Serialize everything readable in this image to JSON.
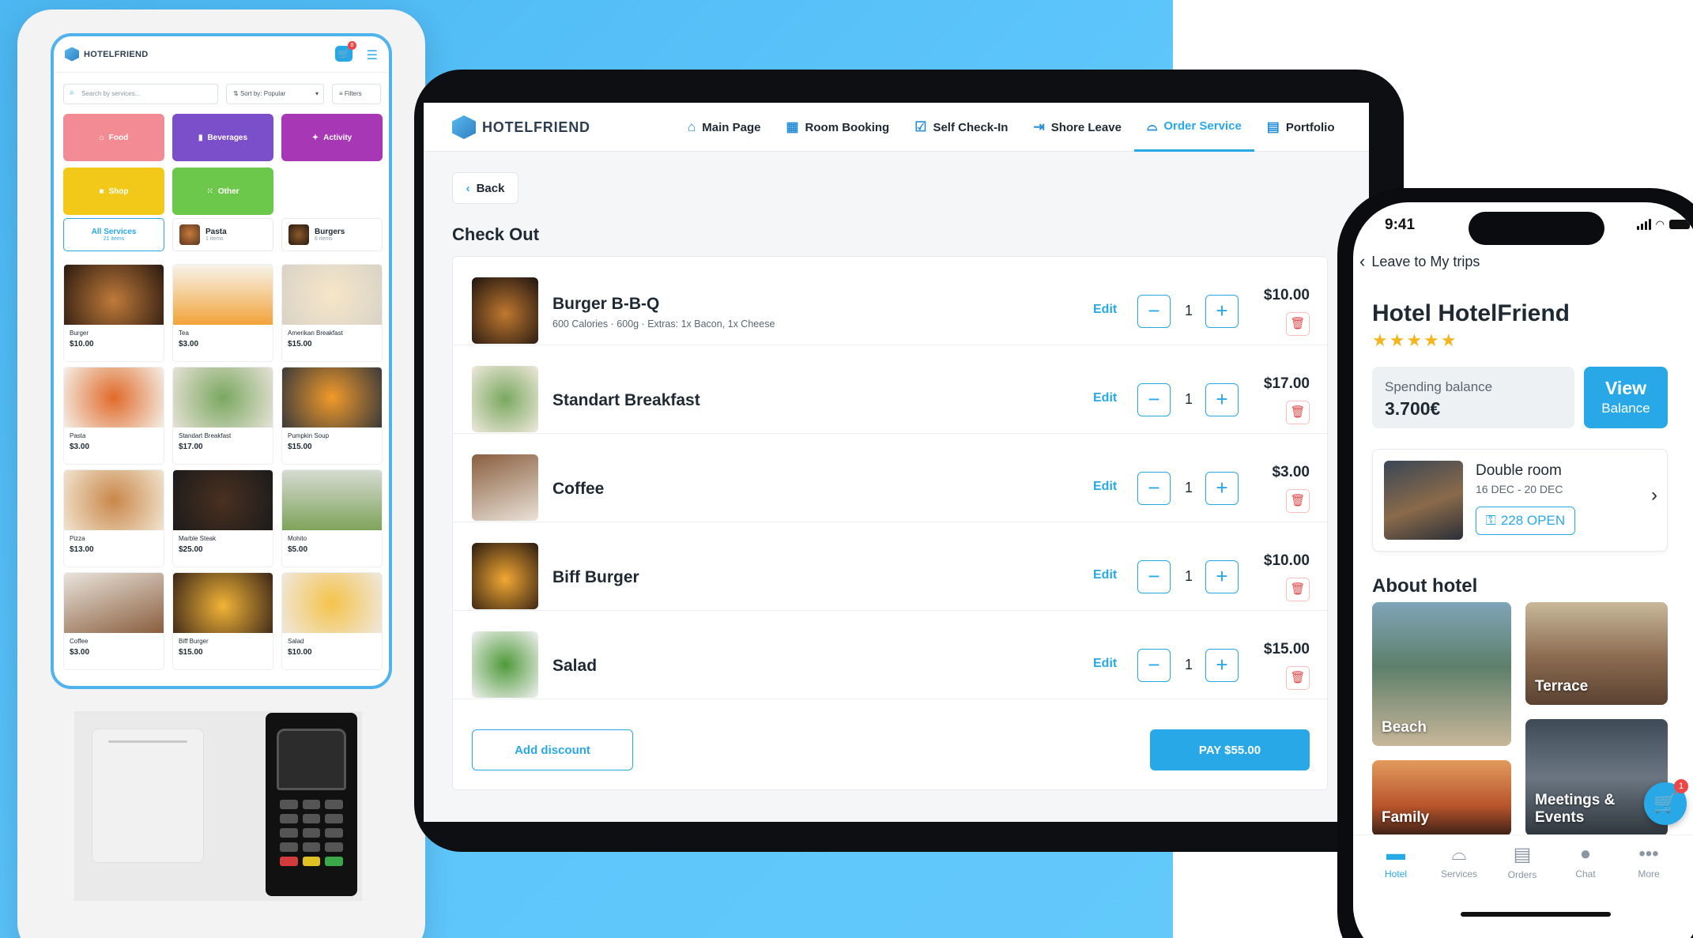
{
  "kiosk": {
    "logo": "HOTELFRIEND",
    "cart_count": "8",
    "search_placeholder": "Search by services...",
    "sort_label": "Sort by: Popular",
    "filters_label": "Filters",
    "categories": [
      {
        "label": "Food",
        "color": "#f28b94"
      },
      {
        "label": "Beverages",
        "color": "#7b4fc9"
      },
      {
        "label": "Activity",
        "color": "#a737b5"
      },
      {
        "label": "Shop",
        "color": "#f2c918"
      },
      {
        "label": "Other",
        "color": "#6cc84a"
      }
    ],
    "tabs": [
      {
        "label": "All Services",
        "sub": "21 items"
      },
      {
        "label": "Pasta",
        "sub": "1 items"
      },
      {
        "label": "Burgers",
        "sub": "6 items"
      }
    ],
    "items": [
      {
        "name": "Burger",
        "price": "$10.00"
      },
      {
        "name": "Tea",
        "price": "$3.00"
      },
      {
        "name": "Amerikan Breakfast",
        "price": "$15.00"
      },
      {
        "name": "Pasta",
        "price": "$3.00"
      },
      {
        "name": "Standart Breakfast",
        "price": "$17.00"
      },
      {
        "name": "Pumpkin Soup",
        "price": "$15.00"
      },
      {
        "name": "Pizza",
        "price": "$13.00"
      },
      {
        "name": "Marble Steak",
        "price": "$25.00"
      },
      {
        "name": "Mohito",
        "price": "$5.00"
      },
      {
        "name": "Coffee",
        "price": "$3.00"
      },
      {
        "name": "Biff Burger",
        "price": "$15.00"
      },
      {
        "name": "Salad",
        "price": "$10.00"
      }
    ]
  },
  "tablet": {
    "logo": "HOTELFRIEND",
    "nav": [
      {
        "label": "Main Page",
        "icon": "home-icon"
      },
      {
        "label": "Room Booking",
        "icon": "calendar-icon"
      },
      {
        "label": "Self Check-In",
        "icon": "check-icon"
      },
      {
        "label": "Shore Leave",
        "icon": "door-exit-icon"
      },
      {
        "label": "Order Service",
        "icon": "cloche-icon"
      },
      {
        "label": "Portfolio",
        "icon": "book-icon"
      }
    ],
    "back_label": "Back",
    "title": "Check Out",
    "edit_label": "Edit",
    "cart": [
      {
        "name": "Burger B-B-Q",
        "desc": "600 Calories · 600g · Extras: 1x Bacon, 1x Cheese",
        "qty": "1",
        "price": "$10.00"
      },
      {
        "name": "Standart Breakfast",
        "desc": "",
        "qty": "1",
        "price": "$17.00"
      },
      {
        "name": "Coffee",
        "desc": "",
        "qty": "1",
        "price": "$3.00"
      },
      {
        "name": "Biff Burger",
        "desc": "",
        "qty": "1",
        "price": "$10.00"
      },
      {
        "name": "Salad",
        "desc": "",
        "qty": "1",
        "price": "$15.00"
      }
    ],
    "discount_label": "Add discount",
    "pay_label": "PAY $55.00"
  },
  "phone": {
    "time": "9:41",
    "back_label": "Leave to My trips",
    "hotel_name": "Hotel HotelFriend",
    "stars": "★★★★★",
    "balance_label": "Spending balance",
    "balance_value": "3.700€",
    "view_label": "View",
    "view_sub": "Balance",
    "room_name": "Double room",
    "room_dates": "16 DEC - 20 DEC",
    "room_key": "228 OPEN",
    "about_title": "About hotel",
    "tiles": [
      "Beach",
      "Terrace",
      "Family",
      "Meetings & Events"
    ],
    "cart_badge": "1",
    "tabs": [
      "Hotel",
      "Services",
      "Orders",
      "Chat",
      "More"
    ]
  }
}
